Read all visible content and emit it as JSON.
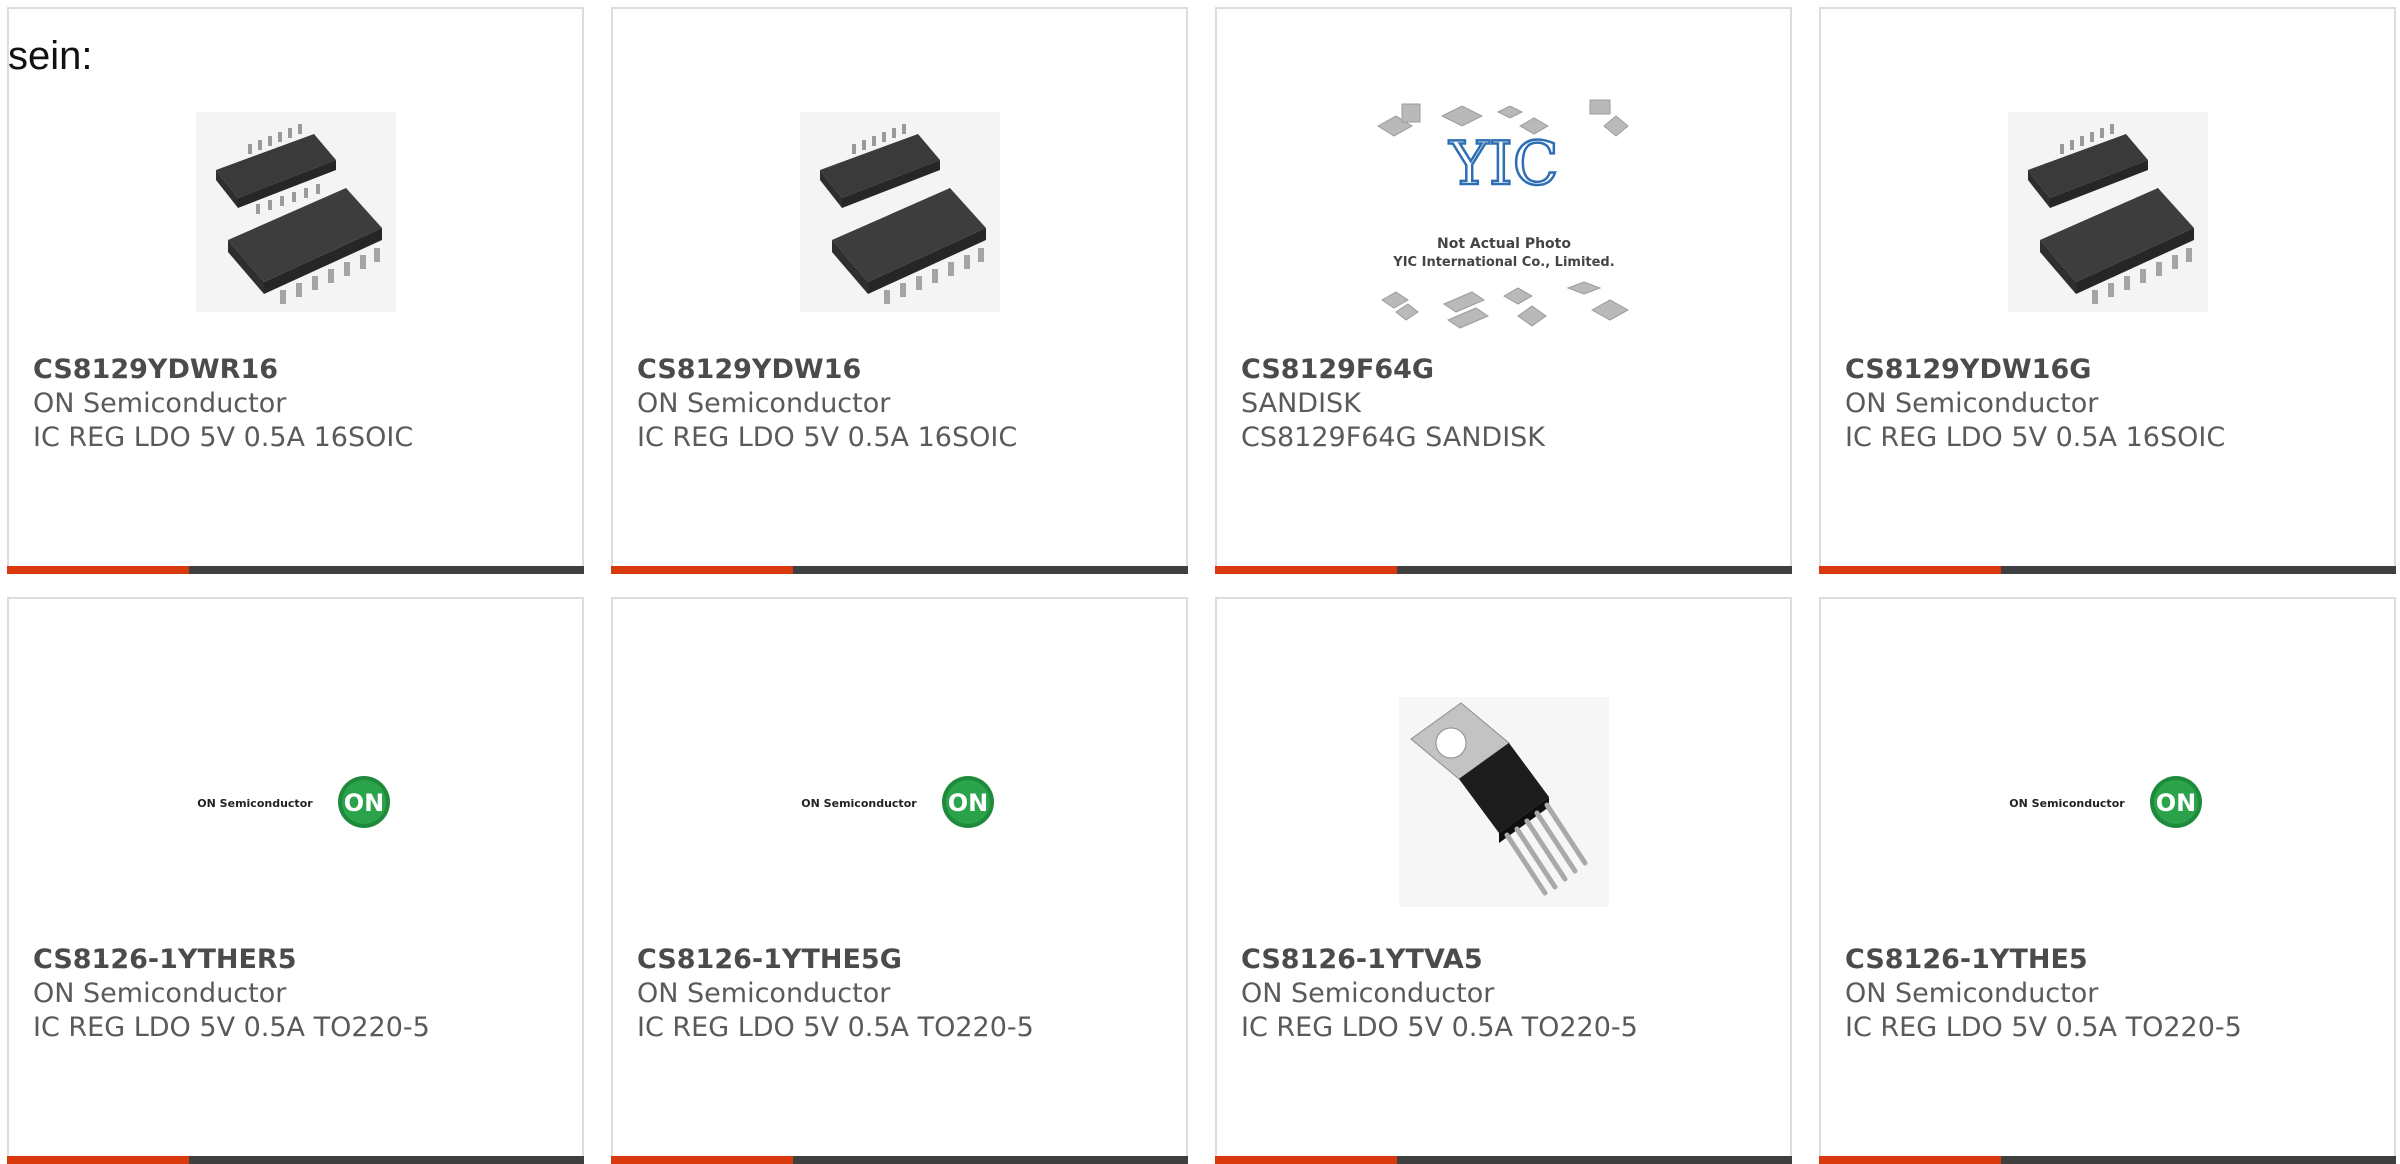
{
  "intro_text": "sein:",
  "colors": {
    "accent": "#d93a0d",
    "bar": "#3f3f3f",
    "border": "#dddddd",
    "on_logo": "#1f8a3c"
  },
  "products": [
    {
      "part": "CS8129YDWR16",
      "manufacturer": "ON Semiconductor",
      "description": "IC REG LDO 5V 0.5A 16SOIC",
      "image": "soic-16-chip-photo"
    },
    {
      "part": "CS8129YDW16",
      "manufacturer": "ON Semiconductor",
      "description": "IC REG LDO 5V 0.5A 16SOIC",
      "image": "soic-16-chip-photo"
    },
    {
      "part": "CS8129F64G",
      "manufacturer": "SANDISK",
      "description": "CS8129F64G SANDISK",
      "image": "yic-placeholder",
      "placeholder": {
        "logo": "YIC",
        "line1": "Not Actual Photo",
        "line2": "YIC International Co., Limited."
      }
    },
    {
      "part": "CS8129YDW16G",
      "manufacturer": "ON Semiconductor",
      "description": "IC REG LDO 5V 0.5A 16SOIC",
      "image": "soic-16-chip-photo"
    },
    {
      "part": "CS8126-1YTHER5",
      "manufacturer": "ON Semiconductor",
      "description": "IC REG LDO 5V 0.5A TO220-5",
      "image": "on-semiconductor-logo",
      "logo": {
        "text": "ON Semiconductor",
        "badge": "ON"
      }
    },
    {
      "part": "CS8126-1YTHE5G",
      "manufacturer": "ON Semiconductor",
      "description": "IC REG LDO 5V 0.5A TO220-5",
      "image": "on-semiconductor-logo",
      "logo": {
        "text": "ON Semiconductor",
        "badge": "ON"
      }
    },
    {
      "part": "CS8126-1YTVA5",
      "manufacturer": "ON Semiconductor",
      "description": "IC REG LDO 5V 0.5A TO220-5",
      "image": "to220-5-package-photo"
    },
    {
      "part": "CS8126-1YTHE5",
      "manufacturer": "ON Semiconductor",
      "description": "IC REG LDO 5V 0.5A TO220-5",
      "image": "on-semiconductor-logo",
      "logo": {
        "text": "ON Semiconductor",
        "badge": "ON"
      }
    }
  ]
}
